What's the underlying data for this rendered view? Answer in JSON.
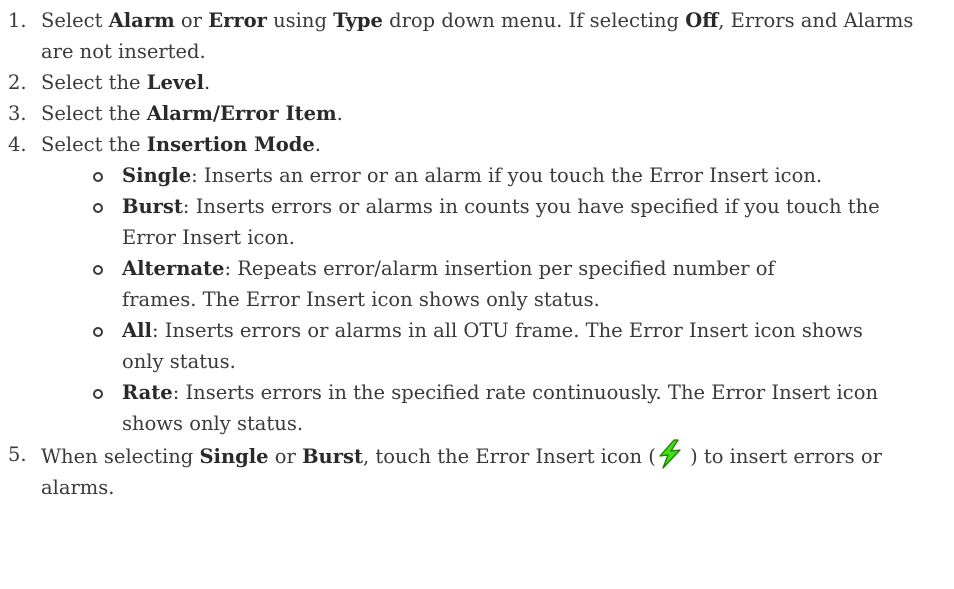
{
  "steps": [
    {
      "number": "1.",
      "parts": [
        "Select ",
        "Alarm",
        " or ",
        "Error",
        " using ",
        "Type",
        " drop down menu. If selecting ",
        "Off",
        ", Errors and Alarms are not inserted."
      ]
    },
    {
      "number": "2.",
      "parts": [
        "Select the ",
        "Level",
        "."
      ]
    },
    {
      "number": "3.",
      "parts": [
        "Select the ",
        "Alarm/Error Item",
        "."
      ]
    },
    {
      "number": "4.",
      "parts": [
        "Select the ",
        "Insertion Mode",
        "."
      ],
      "modes": [
        {
          "term": "Single",
          "desc": ": Inserts an error or an alarm if you touch the Error Insert icon."
        },
        {
          "term": "Burst",
          "desc": ": Inserts errors or alarms in counts you have specified if you touch the Error Insert icon."
        },
        {
          "term": "Alternate",
          "desc": ": Repeats error/alarm insertion per specified number of frames. The Error Insert icon shows only status."
        },
        {
          "term": "All",
          "desc": ": Inserts errors or alarms in all OTU frame. The Error Insert icon shows only status."
        },
        {
          "term": "Rate",
          "desc": ": Inserts errors in the specified rate continuously. The Error Insert icon shows only status."
        }
      ]
    },
    {
      "number": "5.",
      "parts": [
        "When selecting ",
        "Single",
        " or ",
        "Burst",
        ", touch the Error Insert icon (",
        " ) to insert errors or alarms."
      ]
    }
  ],
  "icons": {
    "error_insert": "lightning-bolt-icon"
  },
  "colors": {
    "text": "#3a3a3a",
    "bolt_fill": "#44dd11",
    "bolt_stroke": "#1d7a06"
  }
}
